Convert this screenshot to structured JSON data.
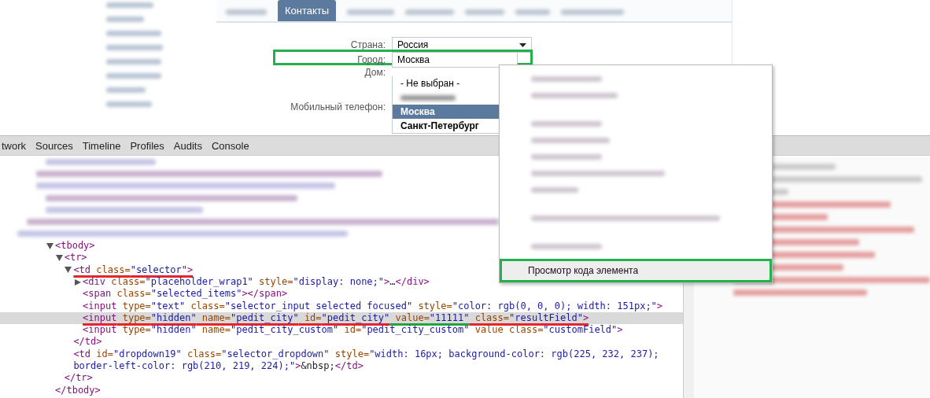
{
  "profile_tabs": [
    {
      "label": "Контакты",
      "selected": true
    }
  ],
  "form": {
    "rows": [
      {
        "label": "Страна:",
        "kind": "select",
        "value": "Россия",
        "annotated": false
      },
      {
        "label": "Город:",
        "kind": "input",
        "value": "Москва",
        "annotated": true
      },
      {
        "label": "Дом:",
        "kind": "blank",
        "annotated": false
      },
      {
        "label": "Мобильный телефон:",
        "kind": "blank",
        "annotated": false
      }
    ],
    "city_options": [
      {
        "kind": "option",
        "text": "- Не выбран -",
        "selected": false,
        "bold": false
      },
      {
        "kind": "blurred"
      },
      {
        "kind": "option",
        "text": "Москва",
        "selected": true,
        "bold": true
      },
      {
        "kind": "option",
        "text": "Санкт-Петербург",
        "selected": false,
        "bold": true
      }
    ]
  },
  "devtools": {
    "tabs": [
      "twork",
      "Sources",
      "Timeline",
      "Profiles",
      "Audits",
      "Console"
    ],
    "tree": [
      {
        "expanded": true,
        "segments": [
          {
            "kind": "tag",
            "text": "<tbody>"
          }
        ],
        "close": "</tbody>",
        "children": [
          {
            "expanded": true,
            "segments": [
              {
                "kind": "tag",
                "text": "<tr>"
              }
            ],
            "close": "</tr>",
            "children": [
              {
                "expanded": true,
                "underlined": true,
                "segments": [
                  {
                    "kind": "tag",
                    "text": "<td"
                  },
                  {
                    "kind": "attr",
                    "text": " class="
                  },
                  {
                    "kind": "value",
                    "text": "\"selector\""
                  },
                  {
                    "kind": "tag",
                    "text": ">"
                  }
                ],
                "close": "</td>",
                "children": [
                  {
                    "expanded": false,
                    "segments": [
                      {
                        "kind": "tag",
                        "text": "<div"
                      },
                      {
                        "kind": "attr",
                        "text": " class="
                      },
                      {
                        "kind": "value",
                        "text": "\"placeholder_wrap1\""
                      },
                      {
                        "kind": "attr",
                        "text": " style="
                      },
                      {
                        "kind": "value",
                        "text": "\"display: none;\""
                      },
                      {
                        "kind": "tag",
                        "text": ">"
                      },
                      {
                        "kind": "text",
                        "text": "…"
                      },
                      {
                        "kind": "tag",
                        "text": "</div>"
                      }
                    ]
                  },
                  {
                    "segments": [
                      {
                        "kind": "tag",
                        "text": "<span"
                      },
                      {
                        "kind": "attr",
                        "text": " class="
                      },
                      {
                        "kind": "value",
                        "text": "\"selected_items\""
                      },
                      {
                        "kind": "tag",
                        "text": "></span>"
                      }
                    ]
                  },
                  {
                    "segments": [
                      {
                        "kind": "tag",
                        "text": "<input"
                      },
                      {
                        "kind": "attr",
                        "text": " type="
                      },
                      {
                        "kind": "value",
                        "text": "\"text\""
                      },
                      {
                        "kind": "attr",
                        "text": " class="
                      },
                      {
                        "kind": "value",
                        "text": "\"selector_input selected focused\""
                      },
                      {
                        "kind": "attr",
                        "text": " style="
                      },
                      {
                        "kind": "value",
                        "text": "\"color: rgb(0, 0, 0); width: 151px;\""
                      },
                      {
                        "kind": "tag",
                        "text": ">"
                      }
                    ]
                  },
                  {
                    "highlighted": true,
                    "underlined": true,
                    "segments": [
                      {
                        "kind": "tag",
                        "text": "<input"
                      },
                      {
                        "kind": "attr",
                        "text": " type="
                      },
                      {
                        "kind": "value",
                        "text": "\"hidden\""
                      },
                      {
                        "kind": "attr",
                        "text": " name="
                      },
                      {
                        "kind": "value",
                        "text": "\"pedit_city\""
                      },
                      {
                        "kind": "attr",
                        "text": " id="
                      },
                      {
                        "kind": "value",
                        "text": "\"pedit_city\""
                      },
                      {
                        "kind": "attr",
                        "text": " value=",
                        "marked": true
                      },
                      {
                        "kind": "value",
                        "text": "\"11111\"",
                        "marked": true
                      },
                      {
                        "kind": "attr",
                        "text": " class="
                      },
                      {
                        "kind": "value",
                        "text": "\"resultField\""
                      },
                      {
                        "kind": "tag",
                        "text": ">"
                      }
                    ]
                  },
                  {
                    "segments": [
                      {
                        "kind": "tag",
                        "text": "<input"
                      },
                      {
                        "kind": "attr",
                        "text": " type="
                      },
                      {
                        "kind": "value",
                        "text": "\"hidden\""
                      },
                      {
                        "kind": "attr",
                        "text": " name="
                      },
                      {
                        "kind": "value",
                        "text": "\"pedit_city_custom\""
                      },
                      {
                        "kind": "attr",
                        "text": " id="
                      },
                      {
                        "kind": "value",
                        "text": "\"pedit_city_custom\""
                      },
                      {
                        "kind": "attr",
                        "text": " value class="
                      },
                      {
                        "kind": "value",
                        "text": "\"customField\""
                      },
                      {
                        "kind": "tag",
                        "text": ">"
                      }
                    ]
                  }
                ]
              },
              {
                "segments": [
                  {
                    "kind": "tag",
                    "text": "<td"
                  },
                  {
                    "kind": "attr",
                    "text": " id="
                  },
                  {
                    "kind": "value",
                    "text": "\"dropdown19\""
                  },
                  {
                    "kind": "attr",
                    "text": " class="
                  },
                  {
                    "kind": "value",
                    "text": "\"selector_dropdown\""
                  },
                  {
                    "kind": "attr",
                    "text": " style="
                  },
                  {
                    "kind": "value",
                    "text": "\"width: 16px; background-color: rgb(225, 232, 237);"
                  }
                ]
              },
              {
                "segments": [
                  {
                    "kind": "value",
                    "text": "border-left-color: rgb(210, 219, 224);\""
                  },
                  {
                    "kind": "tag",
                    "text": ">"
                  },
                  {
                    "kind": "text",
                    "text": "&nbsp;"
                  },
                  {
                    "kind": "tag",
                    "text": "</td>"
                  }
                ]
              }
            ]
          }
        ]
      }
    ]
  },
  "context_menu": {
    "items": [
      {
        "label": "Просмотр кода элемента",
        "highlighted": true,
        "annotated": true
      }
    ]
  }
}
